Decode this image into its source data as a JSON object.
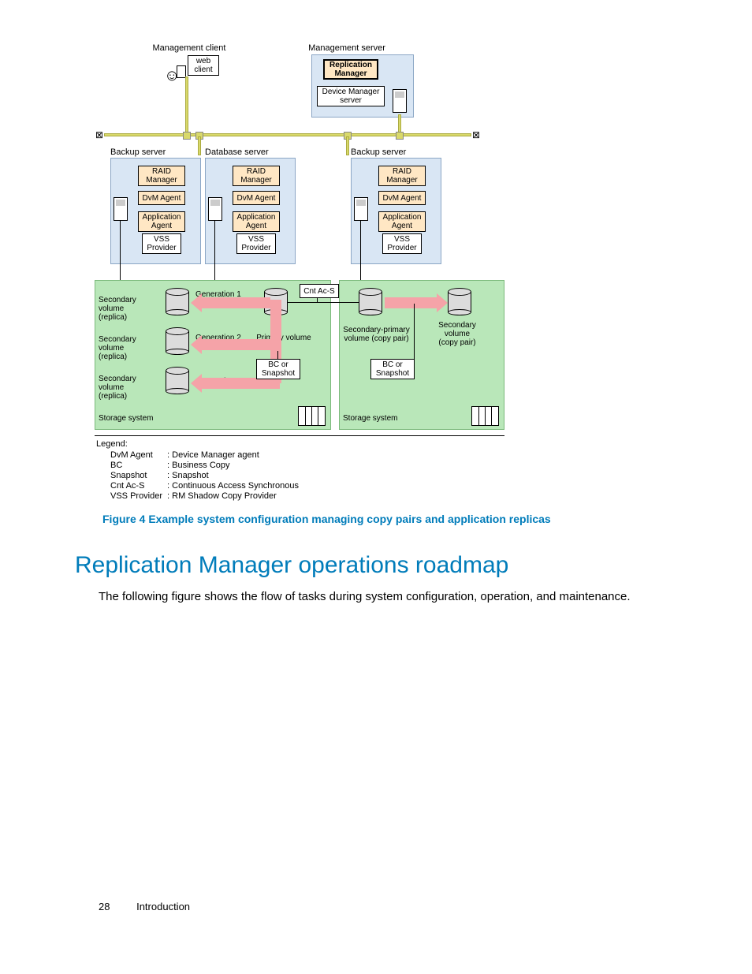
{
  "diagram": {
    "top_labels": {
      "mgmt_client": "Management client",
      "web_client": "web\nclient",
      "mgmt_server": "Management server"
    },
    "mgmt_server_boxes": {
      "rep_mgr": "Replication\nManager",
      "dev_mgr": "Device Manager\nserver"
    },
    "server_labels": {
      "backup": "Backup server",
      "database": "Database server"
    },
    "stack": {
      "raid": "RAID\nManager",
      "dvm": "DvM Agent",
      "app": "Application\nAgent",
      "vss": "VSS\nProvider"
    },
    "cnt_ac_s": "Cnt Ac-S",
    "volumes": {
      "gen1": "Generation 1",
      "gen2": "Generation 2",
      "gen3": "Generation 3",
      "sec_replica": "Secondary\nvolume\n(replica)",
      "primary": "Primary volume",
      "bc_snap": "BC or\nSnapshot",
      "sec_primary": "Secondary-primary\nvolume (copy pair)",
      "sec_copy": "Secondary\nvolume\n(copy pair)",
      "storage_system": "Storage system"
    },
    "legend": {
      "title": "Legend:",
      "rows": [
        {
          "k": "DvM Agent",
          "v": ": Device Manager agent"
        },
        {
          "k": "BC",
          "v": ": Business Copy"
        },
        {
          "k": "Snapshot",
          "v": ": Snapshot"
        },
        {
          "k": "Cnt Ac-S",
          "v": ": Continuous Access Synchronous"
        },
        {
          "k": "VSS Provider",
          "v": ": RM Shadow Copy Provider"
        }
      ]
    }
  },
  "figure_caption": "Figure 4 Example system configuration managing copy pairs and application replicas",
  "heading": "Replication Manager operations roadmap",
  "body": "The following figure shows the flow of tasks during system configuration, operation, and maintenance.",
  "footer": {
    "page": "28",
    "section": "Introduction"
  }
}
